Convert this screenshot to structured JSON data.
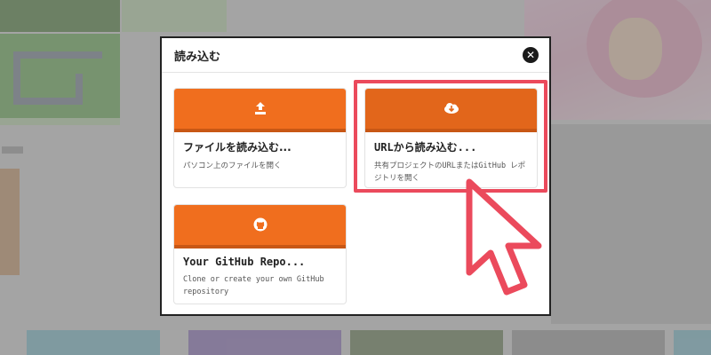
{
  "modal": {
    "title": "読み込む",
    "close_icon": "close-icon"
  },
  "cards": [
    {
      "title": "ファイルを読み込む...",
      "description": "パソコン上のファイルを開く",
      "icon": "upload-icon"
    },
    {
      "title": "URLから読み込む...",
      "description": "共有プロジェクトのURLまたはGitHub レポジトリを開く",
      "icon": "cloud-download-icon"
    },
    {
      "title": "Your GitHub Repo...",
      "description": "Clone or create your own GitHub repository",
      "icon": "github-icon"
    }
  ],
  "colors": {
    "card_header": "#f06e1e",
    "card_header_border": "#c85715",
    "highlight": "#eb4a5c"
  }
}
